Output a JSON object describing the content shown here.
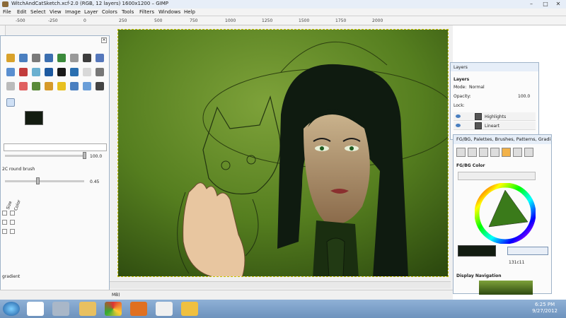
{
  "window": {
    "title": "WitchAndCatSketch.xcf-2.0 (RGB, 12 layers) 1600x1200 – GIMP",
    "controls": [
      "–",
      "□",
      "✕"
    ]
  },
  "menu": [
    "File",
    "Edit",
    "Select",
    "View",
    "Image",
    "Layer",
    "Colors",
    "Tools",
    "Filters",
    "Windows",
    "Help"
  ],
  "ruler": {
    "ticks": [
      "-500",
      "-250",
      "0",
      "250",
      "500",
      "750",
      "1000",
      "1250",
      "1500",
      "1750",
      "2000"
    ]
  },
  "toolbox": {
    "opacity_value": "100.0",
    "brush_name": "2C round brush",
    "scale_value": "0.45",
    "dynamics_labels": [
      "Size",
      "Color"
    ],
    "fade_label": "gradient"
  },
  "status": {
    "memory": "MB)"
  },
  "layers_panel": {
    "title": "Layers",
    "header": "Layers",
    "mode_label": "Mode:",
    "mode_value": "Normal",
    "opacity_label": "Opacity:",
    "opacity_value": "100.0",
    "lock_label": "Lock:",
    "layers": [
      {
        "name": "Highlights"
      },
      {
        "name": "Lineart"
      }
    ]
  },
  "fgbg_panel": {
    "title": "FG/BG, Palettes, Brushes, Patterns, Gradi...",
    "section": "FG/BG Color",
    "hex_value": "131c11",
    "fg_color": "#131c11",
    "display_nav": "Display Navigation"
  },
  "taskbar": {
    "time": "6:25 PM",
    "date": "9/27/2012",
    "apps": [
      "start-orb",
      "picasa",
      "gimp",
      "explorer",
      "chrome",
      "firefox",
      "blender",
      "vlc"
    ]
  },
  "colors": {
    "canvas_bg_top": "#4f7a1e",
    "canvas_bg_bottom": "#2e4a10",
    "fg_swatch": "#131c11"
  }
}
